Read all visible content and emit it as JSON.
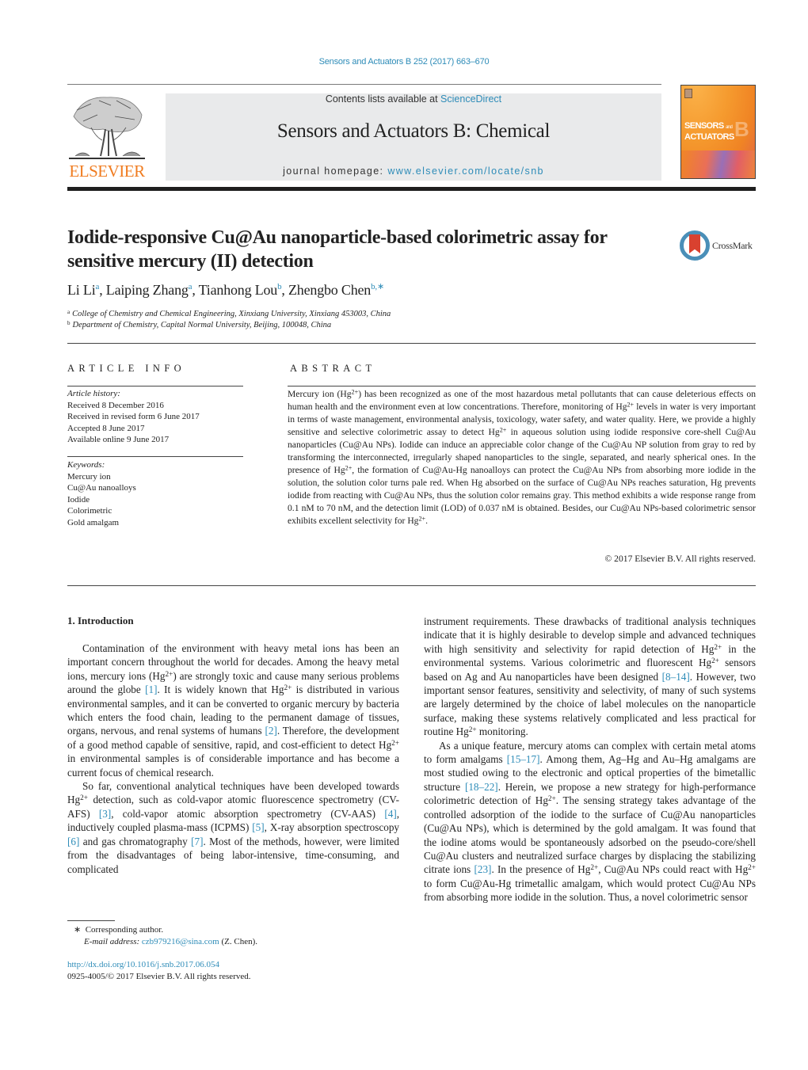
{
  "journal_citation": "Sensors and Actuators B 252 (2017) 663–670",
  "masthead": {
    "contents_prefix": "Contents lists available at ",
    "contents_link": "ScienceDirect",
    "journal_title": "Sensors and Actuators B: Chemical",
    "homepage_prefix": "journal homepage: ",
    "homepage_link": "www.elsevier.com/locate/snb"
  },
  "publisher_logo": {
    "wordmark": "ELSEVIER",
    "icon": "elsevier-tree-icon",
    "color": "#f07c20"
  },
  "journal_cover": {
    "title_line1": "SENSORS",
    "title_and": "and",
    "title_line2": "ACTUATORS",
    "big_letter": "B"
  },
  "crossmark": {
    "label": "CrossMark",
    "ring_color": "#4a8fb8",
    "ribbon_color": "#d9412f"
  },
  "article": {
    "title_line1": "Iodide-responsive Cu@Au nanoparticle-based colorimetric assay for",
    "title_line2": "sensitive mercury (II) detection",
    "authors": [
      {
        "name": "Li Li",
        "affil": "a"
      },
      {
        "name": "Laiping Zhang",
        "affil": "a"
      },
      {
        "name": "Tianhong Lou",
        "affil": "b"
      },
      {
        "name": "Zhengbo Chen",
        "affil": "b,∗"
      }
    ],
    "affiliations": [
      {
        "key": "a",
        "text": "College of Chemistry and Chemical Engineering, Xinxiang University, Xinxiang 453003, China"
      },
      {
        "key": "b",
        "text": "Department of Chemistry, Capital Normal University, Beijing, 100048, China"
      }
    ]
  },
  "article_info": {
    "heading": "ARTICLE INFO",
    "history_label": "Article history:",
    "history": [
      "Received 8 December 2016",
      "Received in revised form 6 June 2017",
      "Accepted 8 June 2017",
      "Available online 9 June 2017"
    ],
    "keywords_label": "Keywords:",
    "keywords": [
      "Mercury ion",
      "Cu@Au nanoalloys",
      "Iodide",
      "Colorimetric",
      "Gold amalgam"
    ]
  },
  "abstract": {
    "heading": "ABSTRACT",
    "segments": [
      "Mercury ion (Hg",
      "2+",
      ") has been recognized as one of the most hazardous metal pollutants that can cause deleterious effects on human health and the environment even at low concentrations. Therefore, moni­toring of Hg",
      "2+",
      " levels in water is very important in terms of waste management, environmental analysis, toxicology, water safety, and water quality. Here, we provide a highly sensitive and selective colori­metric assay to detect Hg",
      "2+",
      " in aqueous solution using iodide responsive core-shell Cu@Au nanoparticles (Cu@Au NPs). Iodide can induce an appreciable color change of the Cu@Au NP solution from gray to red by transforming the interconnected, irregularly shaped nanoparticles to the single, separated, and nearly spherical ones. In the presence of Hg",
      "2+",
      ", the formation of Cu@Au-Hg nanoalloys can protect the Cu@Au NPs from absorbing more iodide in the solution, the solution color turns pale red. When Hg absorbed on the surface of Cu@Au NPs reaches saturation, Hg prevents iodide from reacting with Cu@Au NPs, thus the solution color remains gray. This method exhibits a wide response range from 0.1 nM to 70 nM, and the detection limit (LOD) of 0.037 nM is obtained. Besides, our Cu@Au NPs-based colorimetric sensor exhibits excellent selectivity for Hg",
      "2+",
      "."
    ],
    "copyright": "© 2017 Elsevier B.V. All rights reserved."
  },
  "introduction": {
    "heading": "1.  Introduction",
    "left_paragraphs": [
      [
        {
          "t": "Contamination of the environment with heavy metal ions has been an important concern throughout the world for decades. Among the heavy metal ions, mercury ions (Hg"
        },
        {
          "sup": "2+"
        },
        {
          "t": ") are strongly toxic and cause many serious problems around the globe "
        },
        {
          "ref": "[1]"
        },
        {
          "t": ". It is widely known that Hg"
        },
        {
          "sup": "2+"
        },
        {
          "t": " is distributed in various environmental samples, and it can be converted to organic mercury by bacteria which enters the food chain, leading to the permanent damage of tissues, organs, nervous, and renal systems of humans "
        },
        {
          "ref": "[2]"
        },
        {
          "t": ". Therefore, the develop­ment of a good method capable of sensitive, rapid, and cost-efficient to detect Hg"
        },
        {
          "sup": "2+"
        },
        {
          "t": " in environmental samples is of considerable impor­tance and has become a current focus of chemical research."
        }
      ],
      [
        {
          "t": "So far, conventional analytical techniques have been developed towards Hg"
        },
        {
          "sup": "2+"
        },
        {
          "t": " detection, such as cold-vapor atomic fluorescence spectrometry (CV-AFS) "
        },
        {
          "ref": "[3]"
        },
        {
          "t": ", cold-vapor atomic absorption spec­trometry (CV-AAS) "
        },
        {
          "ref": "[4]"
        },
        {
          "t": ", inductively coupled plasma-mass (ICPMS) "
        },
        {
          "ref": "[5]"
        },
        {
          "t": ", X-ray absorption spectroscopy "
        },
        {
          "ref": "[6]"
        },
        {
          "t": " and gas chromatography "
        },
        {
          "ref": "[7]"
        },
        {
          "t": ". Most of the methods, however, were limited from the disadvan­tages of being labor-intensive, time-consuming, and complicated"
        }
      ]
    ],
    "right_paragraphs": [
      [
        {
          "t": "instrument requirements. These drawbacks of traditional analysis techniques indicate that it is highly desirable to develop simple and advanced techniques with high sensitivity and selectivity for rapid detection of Hg"
        },
        {
          "sup": "2+"
        },
        {
          "t": " in the environmental systems. Various colorimet­ric and fluorescent Hg"
        },
        {
          "sup": "2+"
        },
        {
          "t": " sensors based on Ag and Au nanoparticles have been designed "
        },
        {
          "ref": "[8–14]"
        },
        {
          "t": ". However, two important sensor fea­tures, sensitivity and selectivity, of many of such systems are largely determined by the choice of label molecules on the nanoparti­cle surface, making these systems relatively complicated and less practical for routine Hg"
        },
        {
          "sup": "2+"
        },
        {
          "t": " monitoring."
        }
      ],
      [
        {
          "t": "As a unique feature, mercury atoms can complex with certain metal atoms to form amalgams "
        },
        {
          "ref": "[15–17]"
        },
        {
          "t": ". Among them, Ag–Hg and Au–Hg amalgams are most studied owing to the electronic and optical properties of the bimetallic structure "
        },
        {
          "ref": "[18–22]"
        },
        {
          "t": ". Herein, we propose a new strategy for high-performance colorimetric detec­tion of Hg"
        },
        {
          "sup": "2+"
        },
        {
          "t": ". The sensing strategy takes advantage of the controlled adsorption of the iodide to the surface of Cu@Au nanoparticles (Cu@Au NPs), which is determined by the gold amalgam. It was found that the iodine atoms would be spontaneously adsorbed on the pseudo-core/shell Cu@Au clusters and neutralized surface charges by displacing the stabilizing citrate ions "
        },
        {
          "ref": "[23]"
        },
        {
          "t": ". In the pres­ence of Hg"
        },
        {
          "sup": "2+"
        },
        {
          "t": ", Cu@Au NPs could react with Hg"
        },
        {
          "sup": "2+"
        },
        {
          "t": " to form Cu@Au-Hg trimetallic amalgam, which would protect Cu@Au NPs from absorb­ing more iodide in the solution. Thus, a novel colorimetric sensor"
        }
      ]
    ]
  },
  "footnote": {
    "marker": "∗",
    "corresponding": "Corresponding author.",
    "email_label": "E-mail address:",
    "email": "czb979216@sina.com",
    "email_suffix": " (Z. Chen)."
  },
  "doi": "http://dx.doi.org/10.1016/j.snb.2017.06.054",
  "issn_copyright": "0925-4005/© 2017 Elsevier B.V. All rights reserved.",
  "colors": {
    "link": "#2e8cb8",
    "masthead_bg": "#e9eaeb",
    "elsevier_orange": "#f07c20"
  }
}
